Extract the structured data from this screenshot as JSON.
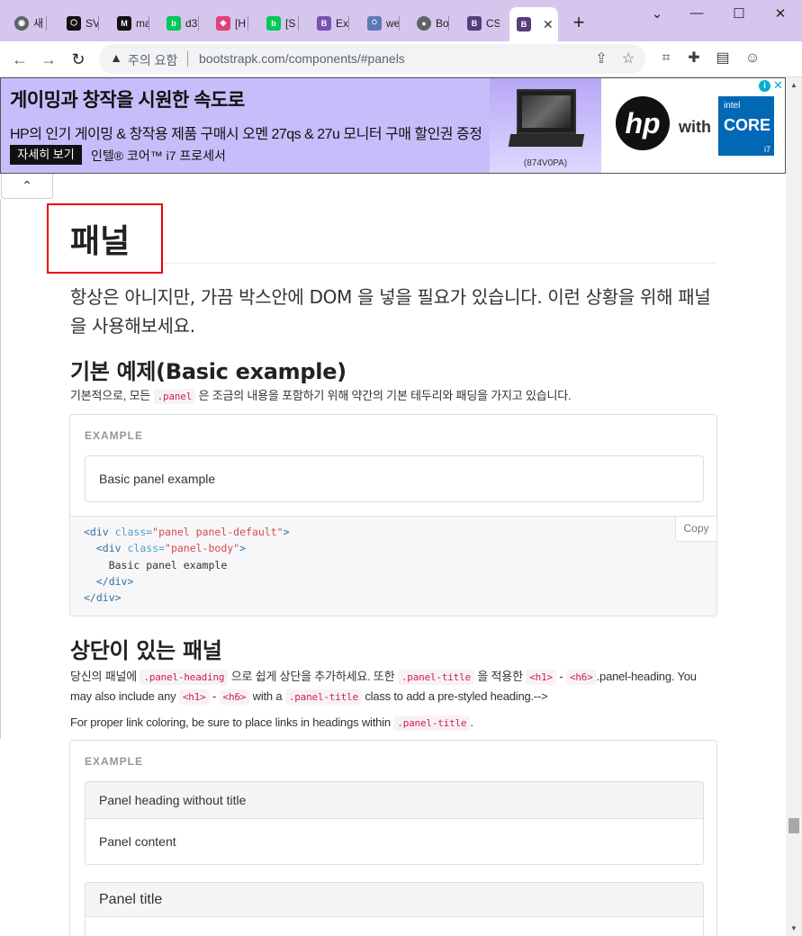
{
  "browser": {
    "tabs": [
      {
        "label": "새",
        "icon": "chrome-icon",
        "color": "#5f6368",
        "glyph": "◉"
      },
      {
        "label": "SV",
        "icon": "codepen-icon",
        "color": "#111111",
        "glyph": "⬡"
      },
      {
        "label": "ma",
        "icon": "medium-icon",
        "color": "#111111",
        "glyph": "M"
      },
      {
        "label": "d3",
        "icon": "blog-icon",
        "color": "#03c75a",
        "glyph": "b"
      },
      {
        "label": "[H",
        "icon": "cube-icon",
        "color": "#e0417a",
        "glyph": "◈"
      },
      {
        "label": "[S",
        "icon": "blog-icon",
        "color": "#03c75a",
        "glyph": "b"
      },
      {
        "label": "Exa",
        "icon": "bootstrap-icon",
        "color": "#7952b3",
        "glyph": "B"
      },
      {
        "label": "we",
        "icon": "webpack-icon",
        "color": "#5b7ab8",
        "glyph": "⍥"
      },
      {
        "label": "Bo",
        "icon": "globe-icon",
        "color": "#5f6368",
        "glyph": "●"
      },
      {
        "label": "CS",
        "icon": "bootstrap-icon",
        "color": "#563d7c",
        "glyph": "B"
      }
    ],
    "active_tab": {
      "icon": "bootstrap-icon",
      "color": "#563d7c",
      "glyph": "B",
      "close": "✕"
    },
    "new_tab": "+",
    "window": {
      "minimize": "—",
      "maximize": "☐",
      "close": "✕",
      "expand": "⌄"
    }
  },
  "toolbar": {
    "back": "←",
    "forward": "→",
    "reload": "↻",
    "security_warn": "▲",
    "security_label": "주의 요함",
    "url": "bootstrapk.com/components/#panels",
    "share": "⇪",
    "bookmark": "☆",
    "camera": "⌗",
    "extensions": "✚",
    "sidepanel": "▤",
    "profile": "☺"
  },
  "ad": {
    "headline": "게이밍과 창작을 시원한 속도로",
    "subline": "HP의 인기 게이밍 & 창작용 제품 구매시 오멘 27qs & 27u 모니터 구매 할인권 증정",
    "cta": "자세히 보기",
    "cpu": "인텔® 코어™ i7 프로세서",
    "model": "(874V0PA)",
    "brand": "hp",
    "with": "with",
    "intel": "intel",
    "core": "CORE",
    "i7": "i7",
    "info": "i",
    "close": "✕"
  },
  "page": {
    "collapse": "⌃",
    "title": "패널",
    "lead": "항상은 아니지만, 가끔 박스안에 DOM 을 넣을 필요가 있습니다. 이런 상황을 위해 패널을 사용해보세요.",
    "basic": {
      "heading": "기본 예제(Basic example)",
      "desc_before": "기본적으로, 모든",
      "desc_code": ".panel",
      "desc_after": "은 조금의 내용을 포함하기 위해 약간의 기본 테두리와 패딩을 가지고 있습니다.",
      "example_label": "EXAMPLE",
      "panel_text": "Basic panel example",
      "copy": "Copy",
      "code": {
        "l1_tag": "<div",
        "l1_attr": " class=",
        "l1_val": "\"panel panel-default\"",
        "l1_end": ">",
        "l2_tag": "  <div",
        "l2_attr": " class=",
        "l2_val": "\"panel-body\"",
        "l2_end": ">",
        "l3": "    Basic panel example",
        "l4": "  </div>",
        "l5": "</div>"
      }
    },
    "heading_section": {
      "heading": "상단이 있는 패널",
      "p1_a": "당신의 패널에",
      "p1_code1": ".panel-heading",
      "p1_b": "으로 쉽게 상단을 추가하세요. 또한",
      "p1_code2": ".panel-title",
      "p1_c": "을 적용한",
      "p1_code3": "<h1>",
      "p1_dash": "-",
      "p1_code4": "<h6>",
      "p1_d": ".panel-heading. You may also include any",
      "p1_code5": "<h1>",
      "p1_dash2": "-",
      "p1_code6": "<h6>",
      "p1_e": "with a",
      "p1_code7": ".panel-title",
      "p1_f": "class to add a pre-styled heading.-->",
      "p2_a": "For proper link coloring, be sure to place links in headings within",
      "p2_code": ".panel-title",
      "p2_b": ".",
      "example_label": "EXAMPLE",
      "panel1_heading": "Panel heading without title",
      "panel1_body": "Panel content",
      "panel2_heading": "Panel title"
    }
  },
  "scrollbar": {
    "up": "▲",
    "down": "▼"
  }
}
